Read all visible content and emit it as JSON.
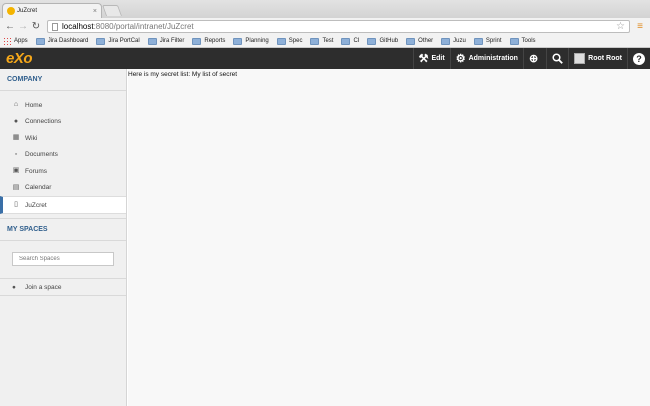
{
  "browser": {
    "tab_title": "JuZcret",
    "tab_close": "×",
    "url_host": "localhost",
    "url_path": ":8080/portal/intranet/JuZcret",
    "bookmarks": [
      {
        "label": "Apps",
        "icon": "apps-icon"
      },
      {
        "label": "Jira Dashboard",
        "icon": "folder-icon"
      },
      {
        "label": "Jira PortCal",
        "icon": "folder-icon"
      },
      {
        "label": "Jira Filter",
        "icon": "folder-icon"
      },
      {
        "label": "Reports",
        "icon": "folder-icon"
      },
      {
        "label": "Planning",
        "icon": "folder-icon"
      },
      {
        "label": "Spec",
        "icon": "folder-icon"
      },
      {
        "label": "Test",
        "icon": "folder-icon"
      },
      {
        "label": "CI",
        "icon": "folder-icon"
      },
      {
        "label": "GitHub",
        "icon": "folder-icon"
      },
      {
        "label": "Other",
        "icon": "folder-icon"
      },
      {
        "label": "Juzu",
        "icon": "folder-icon"
      },
      {
        "label": "Sprint",
        "icon": "folder-icon"
      },
      {
        "label": "Tools",
        "icon": "folder-icon"
      }
    ]
  },
  "topbar": {
    "logo": "eXo",
    "edit_label": "Edit",
    "admin_label": "Administration",
    "user_name": "Root Root",
    "help": "?"
  },
  "sidebar": {
    "company_title": "COMPANY",
    "items": [
      {
        "label": "Home",
        "icon": "home-icon"
      },
      {
        "label": "Connections",
        "icon": "user-icon"
      },
      {
        "label": "Wiki",
        "icon": "wiki-icon"
      },
      {
        "label": "Documents",
        "icon": "folder-icon"
      },
      {
        "label": "Forums",
        "icon": "forum-icon"
      },
      {
        "label": "Calendar",
        "icon": "calendar-icon"
      },
      {
        "label": "JuZcret",
        "icon": "page-icon",
        "active": true
      }
    ],
    "spaces_title": "MY SPACES",
    "search_placeholder": "Search Spaces",
    "join_label": "Join a space"
  },
  "content": {
    "text": "Here is my secret list: My list of secret"
  },
  "colors": {
    "accent": "#2f5e8c",
    "topbar_bg": "#2d2d2d",
    "logo": "#f6a81a"
  }
}
